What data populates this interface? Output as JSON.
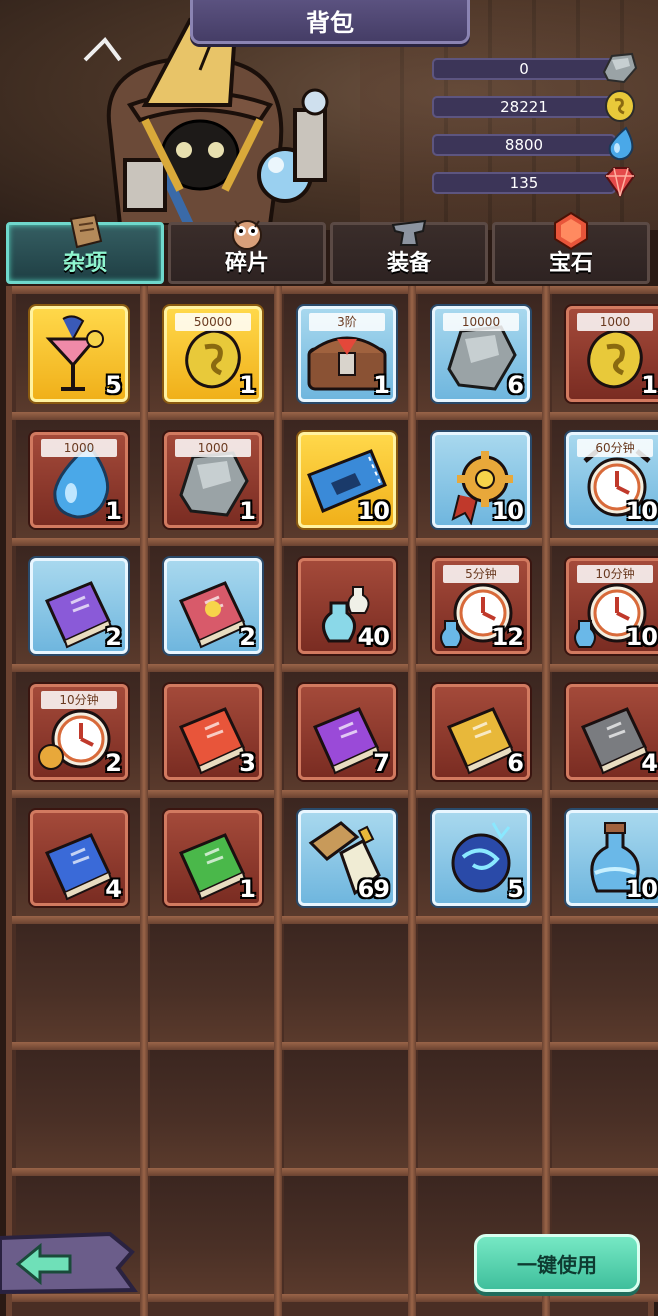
{
  "title": "背包",
  "resources": [
    {
      "name": "stone",
      "value": "0",
      "icon": "stone-icon"
    },
    {
      "name": "coin",
      "value": "28221",
      "icon": "coin-icon"
    },
    {
      "name": "water",
      "value": "8800",
      "icon": "water-drop-icon"
    },
    {
      "name": "gem",
      "value": "135",
      "icon": "gem-icon"
    }
  ],
  "tabs": [
    {
      "label": "杂项",
      "active": true,
      "icon": "scroll-icon"
    },
    {
      "label": "碎片",
      "active": false,
      "icon": "owl-icon"
    },
    {
      "label": "装备",
      "active": false,
      "icon": "anvil-icon"
    },
    {
      "label": "宝石",
      "active": false,
      "icon": "ruby-icon"
    }
  ],
  "items": [
    {
      "icon": "cocktail-icon",
      "tag": "",
      "count": "5",
      "frame": "gold"
    },
    {
      "icon": "coin-icon",
      "tag": "50000",
      "count": "1",
      "frame": "gold"
    },
    {
      "icon": "treasure-chest-icon",
      "tag": "3阶",
      "count": "1",
      "frame": "blue"
    },
    {
      "icon": "stone-icon",
      "tag": "10000",
      "count": "6",
      "frame": "blue"
    },
    {
      "icon": "coin-icon",
      "tag": "1000",
      "count": "1",
      "frame": "red"
    },
    {
      "icon": "water-drop-icon",
      "tag": "1000",
      "count": "1",
      "frame": "red"
    },
    {
      "icon": "stone-icon",
      "tag": "1000",
      "count": "1",
      "frame": "red"
    },
    {
      "icon": "ticket-icon",
      "tag": "",
      "count": "10",
      "frame": "gold"
    },
    {
      "icon": "gear-medal-icon",
      "tag": "",
      "count": "10",
      "frame": "blue"
    },
    {
      "icon": "clock-icon",
      "tag": "60分钟",
      "count": "10",
      "frame": "blue"
    },
    {
      "icon": "purple-book-icon",
      "tag": "",
      "count": "2",
      "frame": "blue"
    },
    {
      "icon": "red-book-icon",
      "tag": "",
      "count": "2",
      "frame": "blue"
    },
    {
      "icon": "potion-icon",
      "tag": "",
      "count": "40",
      "frame": "red"
    },
    {
      "icon": "clock-potion-icon",
      "tag": "5分钟",
      "count": "12",
      "frame": "red"
    },
    {
      "icon": "clock-potion-icon",
      "tag": "10分钟",
      "count": "10",
      "frame": "red"
    },
    {
      "icon": "clock-gear-icon",
      "tag": "10分钟",
      "count": "2",
      "frame": "red"
    },
    {
      "icon": "red-scroll-book-icon",
      "tag": "",
      "count": "3",
      "frame": "red"
    },
    {
      "icon": "purple-scroll-book-icon",
      "tag": "",
      "count": "7",
      "frame": "red"
    },
    {
      "icon": "yellow-scroll-book-icon",
      "tag": "",
      "count": "6",
      "frame": "red"
    },
    {
      "icon": "gray-scroll-book-icon",
      "tag": "",
      "count": "4",
      "frame": "red"
    },
    {
      "icon": "blue-scroll-book-icon",
      "tag": "",
      "count": "4",
      "frame": "red"
    },
    {
      "icon": "green-scroll-book-icon",
      "tag": "",
      "count": "1",
      "frame": "red"
    },
    {
      "icon": "glue-plank-icon",
      "tag": "",
      "count": "69",
      "frame": "blue"
    },
    {
      "icon": "magic-orb-icon",
      "tag": "",
      "count": "5",
      "frame": "blue"
    },
    {
      "icon": "blue-potion-icon",
      "tag": "",
      "count": "10",
      "frame": "blue"
    }
  ],
  "buttons": {
    "back_icon": "back-arrow-icon",
    "use_all_label": "一键使用"
  },
  "colors": {
    "active_tab": "#6fd8cc",
    "use_button": "#5ad6b1",
    "title_banner": "#5b5280"
  }
}
